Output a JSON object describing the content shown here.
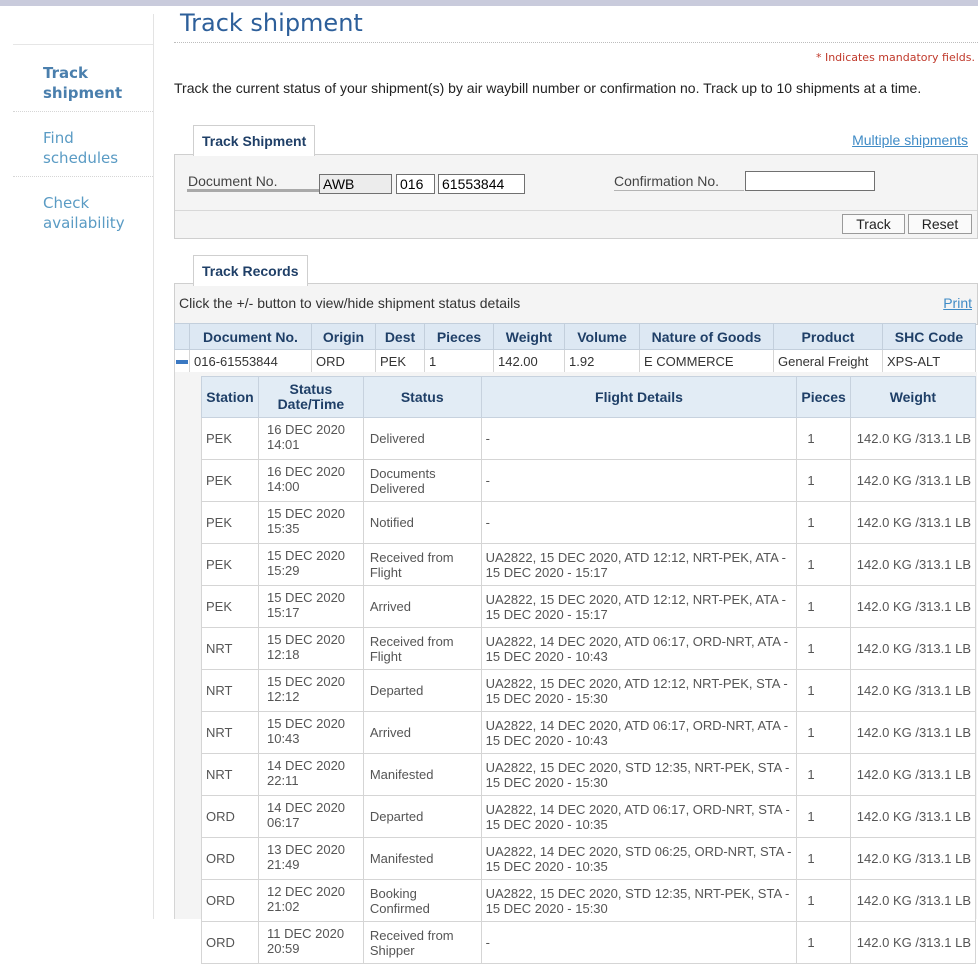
{
  "page": {
    "title": "Track shipment",
    "mandatory_note": "* Indicates mandatory fields.",
    "intro": "Track the current status of your shipment(s) by air waybill number or confirmation no. Track up to 10 shipments at a time."
  },
  "sidebar": {
    "items": [
      {
        "label": "Track shipment"
      },
      {
        "label": "Find schedules"
      },
      {
        "label": "Check availability"
      }
    ]
  },
  "form": {
    "tab_label": "Track Shipment",
    "multiple_link": "Multiple shipments",
    "doc_label": "Document No.",
    "doc_type_value": "AWB",
    "prefix_value": "016",
    "number_value": "61553844",
    "confirmation_label": "Confirmation No.",
    "confirmation_value": "",
    "track_button": "Track",
    "reset_button": "Reset"
  },
  "records": {
    "tab_label": "Track Records",
    "instruction": "Click the +/- button to view/hide shipment status details",
    "print_link": "Print",
    "columns": [
      "Document No.",
      "Origin",
      "Dest",
      "Pieces",
      "Weight",
      "Volume",
      "Nature of Goods",
      "Product",
      "SHC Code"
    ],
    "row": {
      "document_no": "016-61553844",
      "origin": "ORD",
      "dest": "PEK",
      "pieces": "1",
      "weight": "142.00",
      "volume": "1.92",
      "nature_of_goods": "E COMMERCE",
      "product": "General Freight",
      "shc_code": "XPS-ALT"
    }
  },
  "details": {
    "columns": [
      "Station",
      "Status Date/Time",
      "Status",
      "Flight Details",
      "Pieces",
      "Weight"
    ],
    "rows": [
      {
        "station": "PEK",
        "date": "16 DEC 2020",
        "time": "14:01",
        "status": "Delivered",
        "flight": "-",
        "pieces": "1",
        "weight": "142.0 KG /313.1 LB"
      },
      {
        "station": "PEK",
        "date": "16 DEC 2020",
        "time": "14:00",
        "status": "Documents Delivered",
        "flight": "-",
        "pieces": "1",
        "weight": "142.0 KG /313.1 LB"
      },
      {
        "station": "PEK",
        "date": "15 DEC 2020",
        "time": "15:35",
        "status": "Notified",
        "flight": "-",
        "pieces": "1",
        "weight": "142.0 KG /313.1 LB"
      },
      {
        "station": "PEK",
        "date": "15 DEC 2020",
        "time": "15:29",
        "status": "Received from Flight",
        "flight": "UA2822, 15 DEC 2020, ATD 12:12, NRT-PEK, ATA - 15 DEC 2020 - 15:17",
        "pieces": "1",
        "weight": "142.0 KG /313.1 LB"
      },
      {
        "station": "PEK",
        "date": "15 DEC 2020",
        "time": "15:17",
        "status": "Arrived",
        "flight": "UA2822, 15 DEC 2020, ATD 12:12, NRT-PEK, ATA - 15 DEC 2020 - 15:17",
        "pieces": "1",
        "weight": "142.0 KG /313.1 LB"
      },
      {
        "station": "NRT",
        "date": "15 DEC 2020",
        "time": "12:18",
        "status": "Received from Flight",
        "flight": "UA2822, 14 DEC 2020, ATD 06:17, ORD-NRT, ATA - 15 DEC 2020 - 10:43",
        "pieces": "1",
        "weight": "142.0 KG /313.1 LB"
      },
      {
        "station": "NRT",
        "date": "15 DEC 2020",
        "time": "12:12",
        "status": "Departed",
        "flight": "UA2822, 15 DEC 2020, ATD 12:12, NRT-PEK, STA - 15 DEC 2020 - 15:30",
        "pieces": "1",
        "weight": "142.0 KG /313.1 LB"
      },
      {
        "station": "NRT",
        "date": "15 DEC 2020",
        "time": "10:43",
        "status": "Arrived",
        "flight": "UA2822, 14 DEC 2020, ATD 06:17, ORD-NRT, ATA - 15 DEC 2020 - 10:43",
        "pieces": "1",
        "weight": "142.0 KG /313.1 LB"
      },
      {
        "station": "NRT",
        "date": "14 DEC 2020",
        "time": "22:11",
        "status": "Manifested",
        "flight": "UA2822, 15 DEC 2020, STD 12:35, NRT-PEK, STA - 15 DEC 2020 - 15:30",
        "pieces": "1",
        "weight": "142.0 KG /313.1 LB"
      },
      {
        "station": "ORD",
        "date": "14 DEC 2020",
        "time": "06:17",
        "status": "Departed",
        "flight": "UA2822, 14 DEC 2020, ATD 06:17, ORD-NRT, STA - 15 DEC 2020 - 10:35",
        "pieces": "1",
        "weight": "142.0 KG /313.1 LB"
      },
      {
        "station": "ORD",
        "date": "13 DEC 2020",
        "time": "21:49",
        "status": "Manifested",
        "flight": "UA2822, 14 DEC 2020, STD 06:25, ORD-NRT, STA - 15 DEC 2020 - 10:35",
        "pieces": "1",
        "weight": "142.0 KG /313.1 LB"
      },
      {
        "station": "ORD",
        "date": "12 DEC 2020",
        "time": "21:02",
        "status": "Booking Confirmed",
        "flight": "UA2822, 15 DEC 2020, STD 12:35, NRT-PEK, STA - 15 DEC 2020 - 15:30",
        "pieces": "1",
        "weight": "142.0 KG /313.1 LB"
      },
      {
        "station": "ORD",
        "date": "11 DEC 2020",
        "time": "20:59",
        "status": "Received from Shipper",
        "flight": "-",
        "pieces": "1",
        "weight": "142.0 KG /313.1 LB"
      }
    ]
  },
  "colors": {
    "title": "#2d5f9a",
    "link": "#3f8bc6",
    "header_bg": "#dde8f3",
    "mandatory": "#c0392b"
  }
}
